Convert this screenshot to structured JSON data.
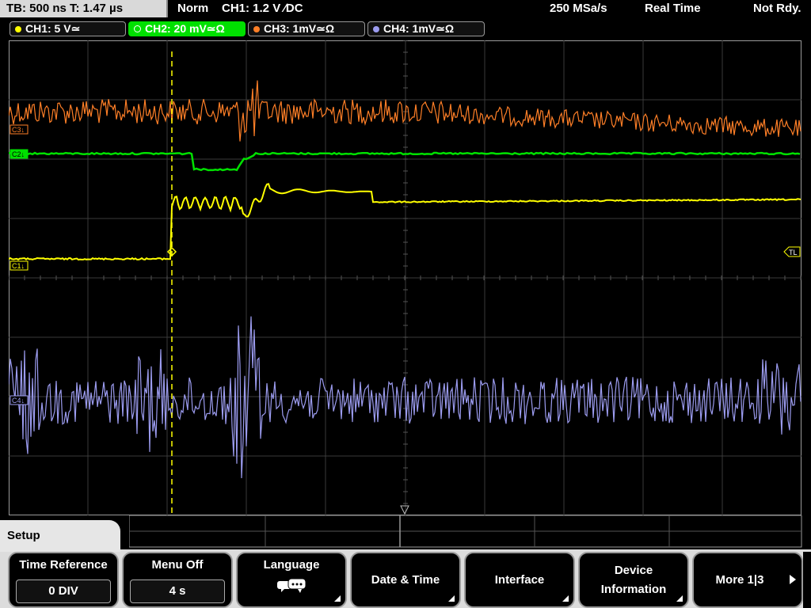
{
  "topbar": {
    "timebase": "TB: 500 ns  T: 1.47 µs",
    "mode": "Norm",
    "trigger": "CH1: 1.2 V ∕DC",
    "sample_rate": "250 MSa/s",
    "acq_mode": "Real Time",
    "status": "Not Rdy."
  },
  "channels": [
    {
      "label": "CH1: 5 V≃",
      "color": "#ffff00",
      "active": false
    },
    {
      "label": "CH2: 20 mV≃Ω",
      "color": "#00e000",
      "active": true
    },
    {
      "label": "CH3: 1mV≃Ω",
      "color": "#ff7f27",
      "active": false
    },
    {
      "label": "CH4: 1mV≃Ω",
      "color": "#9c9cf0",
      "active": false
    }
  ],
  "markers": {
    "ch3": "C3↓",
    "ch2": "C2↓",
    "ch1": "C1↓",
    "ch4": "C4↓",
    "trigger_level": "TL",
    "trigger_pos": "T"
  },
  "menu": {
    "title": "Setup",
    "softkeys": [
      {
        "label": "Time Reference",
        "value": "0 DIV"
      },
      {
        "label": "Menu Off",
        "value": "4 s"
      },
      {
        "label": "Language",
        "icon": "speech-bubbles-icon"
      },
      {
        "label": "Date & Time"
      },
      {
        "label": "Interface"
      },
      {
        "label": "Device\nInformation",
        "line1": "Device",
        "line2": "Information"
      },
      {
        "label": "More 1|3"
      }
    ]
  },
  "colors": {
    "ch1": "#ffff00",
    "ch2": "#00e000",
    "ch3": "#ff7f27",
    "ch4": "#9c9cf0",
    "grid": "#5a5a5a",
    "trigger_line": "#ffff00"
  }
}
